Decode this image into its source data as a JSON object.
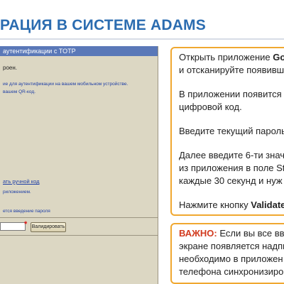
{
  "slide": {
    "title": "РАЦИЯ В СИСТЕМЕ ADAMS"
  },
  "app": {
    "header": "аутентификации с TOTP",
    "status_line": "роен.",
    "instruction_line1": "ие для аутентификации на вашем мобильном устройстве.",
    "instruction_line2": "вашем QR-код.",
    "manual_link": "ать ручной код",
    "app_line": "риложением.",
    "required_line": "ется введение пароля",
    "code_value": "",
    "validate_label": "Валидировать"
  },
  "instructions": {
    "p1_line1_prefix": "Открыть приложение ",
    "p1_line1_bold": "Go",
    "p1_line2": "и отсканируйте появивш",
    "p2_line1": "В приложении появится",
    "p2_line2": "цифровой код.",
    "p3_line1": "Введите текущий пароль",
    "p4_line1": "Далее введите 6-ти знач",
    "p4_line2": "из приложения в поле St",
    "p4_line3": "каждые 30 секунд и нуж",
    "p5_prefix": "Нажмите кнопку ",
    "p5_bold": "Validate"
  },
  "important": {
    "label": "ВАЖНО:",
    "line1_rest": " Если вы все вво",
    "line2": "экране появляется надпи",
    "line3": "необходимо в приложен",
    "line4": "телефона синхронизиро"
  },
  "colors": {
    "title": "#2b6cb0",
    "accent_border": "#f0a830",
    "important": "#d23b1f",
    "app_header": "#5a78b8",
    "app_bg": "#dcd7c3"
  }
}
